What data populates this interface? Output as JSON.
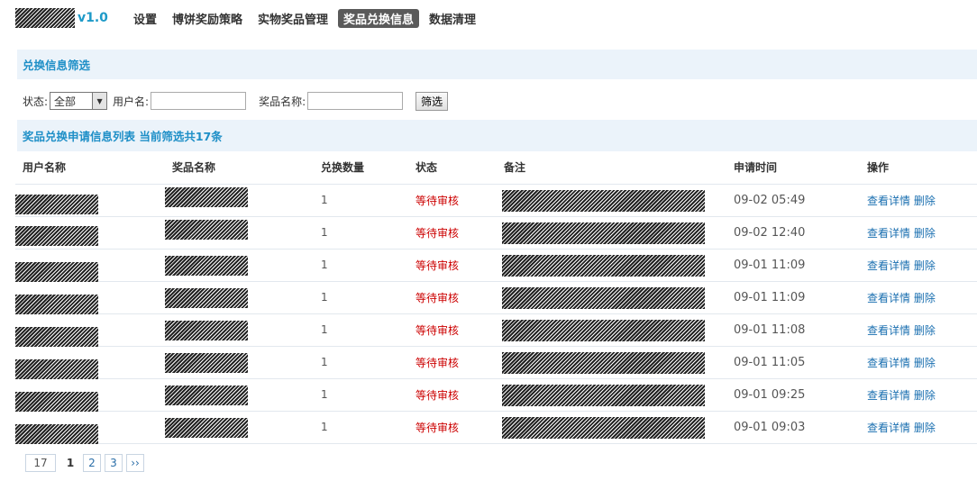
{
  "nav": {
    "version": "v1.0",
    "items": [
      {
        "label": "设置",
        "active": false
      },
      {
        "label": "博饼奖励策略",
        "active": false
      },
      {
        "label": "实物奖品管理",
        "active": false
      },
      {
        "label": "奖品兑换信息",
        "active": true
      },
      {
        "label": "数据清理",
        "active": false
      }
    ]
  },
  "filter": {
    "title": "兑换信息筛选",
    "status_label": "状态:",
    "status_value": "全部",
    "username_label": "用户名:",
    "username_value": "",
    "prize_label": "奖品名称:",
    "prize_value": "",
    "submit_label": "筛选"
  },
  "list": {
    "title": "奖品兑换申请信息列表 当前筛选共17条",
    "headers": [
      "用户名称",
      "奖品名称",
      "兑换数量",
      "状态",
      "备注",
      "申请时间",
      "操作"
    ],
    "rows": [
      {
        "quantity": "1",
        "status": "等待审核",
        "time": "09-02 05:49"
      },
      {
        "quantity": "1",
        "status": "等待审核",
        "time": "09-02 12:40"
      },
      {
        "quantity": "1",
        "status": "等待审核",
        "time": "09-01 11:09"
      },
      {
        "quantity": "1",
        "status": "等待审核",
        "time": "09-01 11:09"
      },
      {
        "quantity": "1",
        "status": "等待审核",
        "time": "09-01 11:08"
      },
      {
        "quantity": "1",
        "status": "等待审核",
        "time": "09-01 11:05"
      },
      {
        "quantity": "1",
        "status": "等待审核",
        "time": "09-01 09:25"
      },
      {
        "quantity": "1",
        "status": "等待审核",
        "time": "09-01 09:03"
      }
    ],
    "action_view": "查看详情",
    "action_delete": "删除"
  },
  "pagination": {
    "total": "17",
    "current": "1",
    "pages": [
      "2",
      "3"
    ],
    "next": "››"
  }
}
